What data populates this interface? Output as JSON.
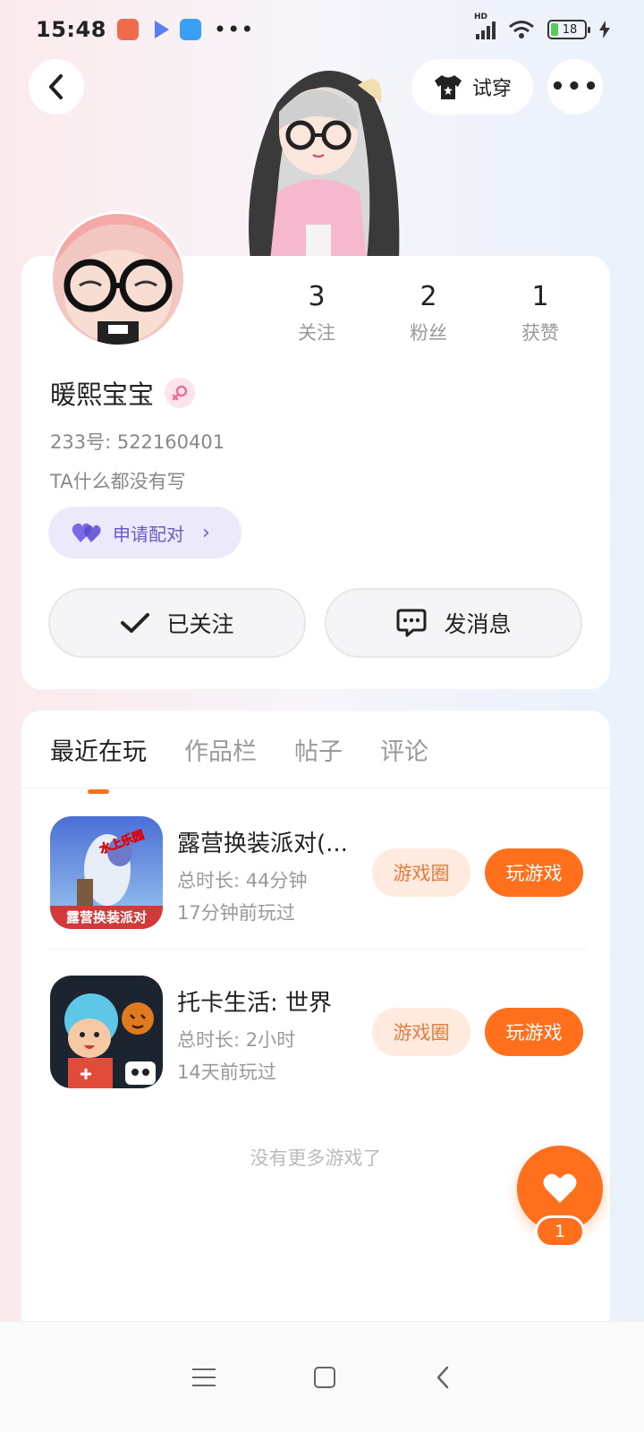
{
  "status_bar": {
    "time": "15:48",
    "battery": "18",
    "dots": "•••",
    "hd_label": "HD"
  },
  "header": {
    "try_on_label": "试穿",
    "more_label": "•••"
  },
  "profile": {
    "stats": [
      {
        "value": "3",
        "label": "关注"
      },
      {
        "value": "2",
        "label": "粉丝"
      },
      {
        "value": "1",
        "label": "获赞"
      }
    ],
    "nickname": "暖熙宝宝",
    "user_id": "233号: 522160401",
    "bio": "TA什么都没有写",
    "pair_label": "申请配对",
    "follow_label": "已关注",
    "message_label": "发消息"
  },
  "tabs": [
    "最近在玩",
    "作品栏",
    "帖子",
    "评论"
  ],
  "games": [
    {
      "title": "露营换装派对(...",
      "total_time": "总时长: 44分钟",
      "last_played": "17分钟前玩过",
      "icon_text_top": "水上乐园",
      "icon_text_bottom": "露营换装派对",
      "circle_label": "游戏圈",
      "play_label": "玩游戏"
    },
    {
      "title": "托卡生活: 世界",
      "total_time": "总时长: 2小时",
      "last_played": "14天前玩过",
      "circle_label": "游戏圈",
      "play_label": "玩游戏"
    }
  ],
  "no_more_text": "没有更多游戏了",
  "like_fab": {
    "count": "1"
  },
  "colors": {
    "accent": "#ff6f1c",
    "pair_purple": "#6a5acd",
    "light_peach": "#ffeadf"
  }
}
